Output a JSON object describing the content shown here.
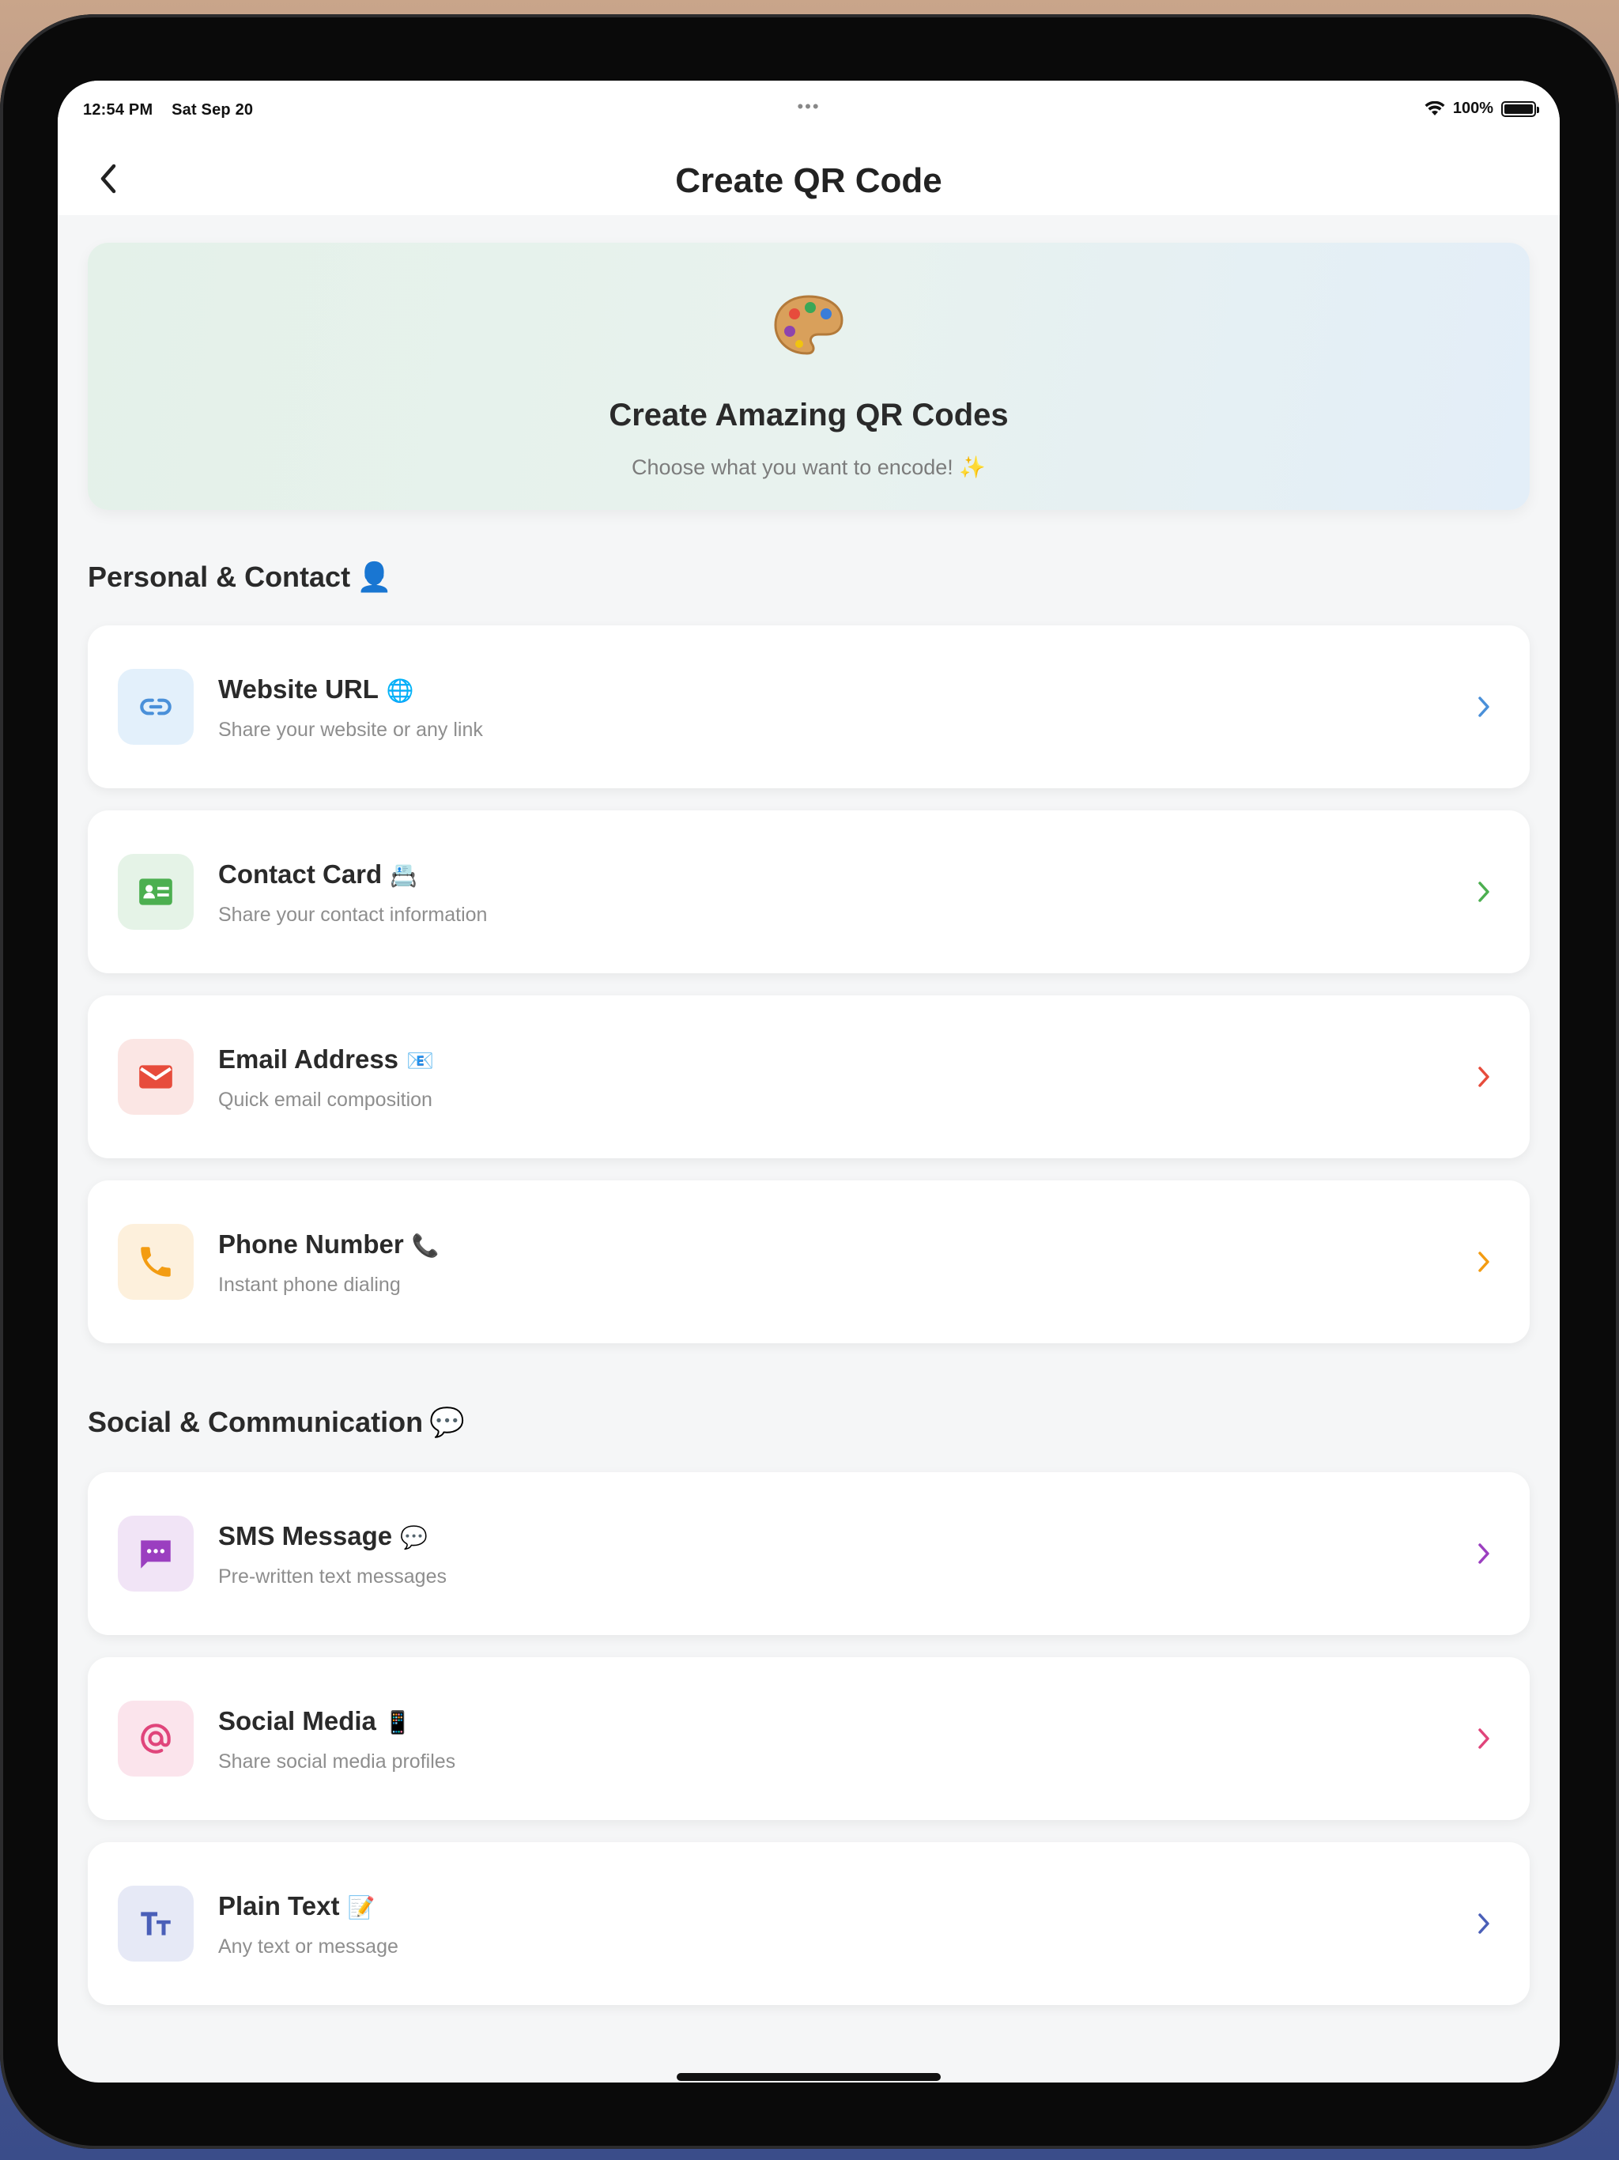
{
  "status_bar": {
    "time": "12:54 PM",
    "date": "Sat Sep 20",
    "dots": "•••",
    "battery": "100%"
  },
  "nav": {
    "title": "Create QR Code",
    "back_icon": "chevron-left-icon"
  },
  "hero": {
    "emoji": "palette-icon",
    "title": "Create Amazing QR Codes",
    "subtitle": "Choose what you want to encode! ✨"
  },
  "sections": [
    {
      "title": "Personal & Contact",
      "emoji": "👤",
      "items": [
        {
          "title": "Website URL",
          "emoji": "🌐",
          "subtitle": "Share your website or any link",
          "icon": "link-icon",
          "accent": "#4a90d9",
          "bg": "#e3f0fb"
        },
        {
          "title": "Contact Card",
          "emoji": "📇",
          "subtitle": "Share your contact information",
          "icon": "contact-card-icon",
          "accent": "#4caf50",
          "bg": "#e5f3e7"
        },
        {
          "title": "Email Address",
          "emoji": "📧",
          "subtitle": "Quick email composition",
          "icon": "email-icon",
          "accent": "#e74c3c",
          "bg": "#fbe6e4"
        },
        {
          "title": "Phone Number",
          "emoji": "📞",
          "subtitle": "Instant phone dialing",
          "icon": "phone-icon",
          "accent": "#f39c12",
          "bg": "#fdf0dc"
        }
      ]
    },
    {
      "title": "Social & Communication",
      "emoji": "💬",
      "items": [
        {
          "title": "SMS Message",
          "emoji": "💬",
          "subtitle": "Pre-written text messages",
          "icon": "sms-icon",
          "accent": "#9b3fc0",
          "bg": "#f1e4f6"
        },
        {
          "title": "Social Media",
          "emoji": "📱",
          "subtitle": "Share social media profiles",
          "icon": "at-sign-icon",
          "accent": "#e0457b",
          "bg": "#fbe4ec"
        },
        {
          "title": "Plain Text",
          "emoji": "📝",
          "subtitle": "Any text or message",
          "icon": "text-format-icon",
          "accent": "#4a5fb8",
          "bg": "#e6e9f6"
        }
      ]
    }
  ]
}
